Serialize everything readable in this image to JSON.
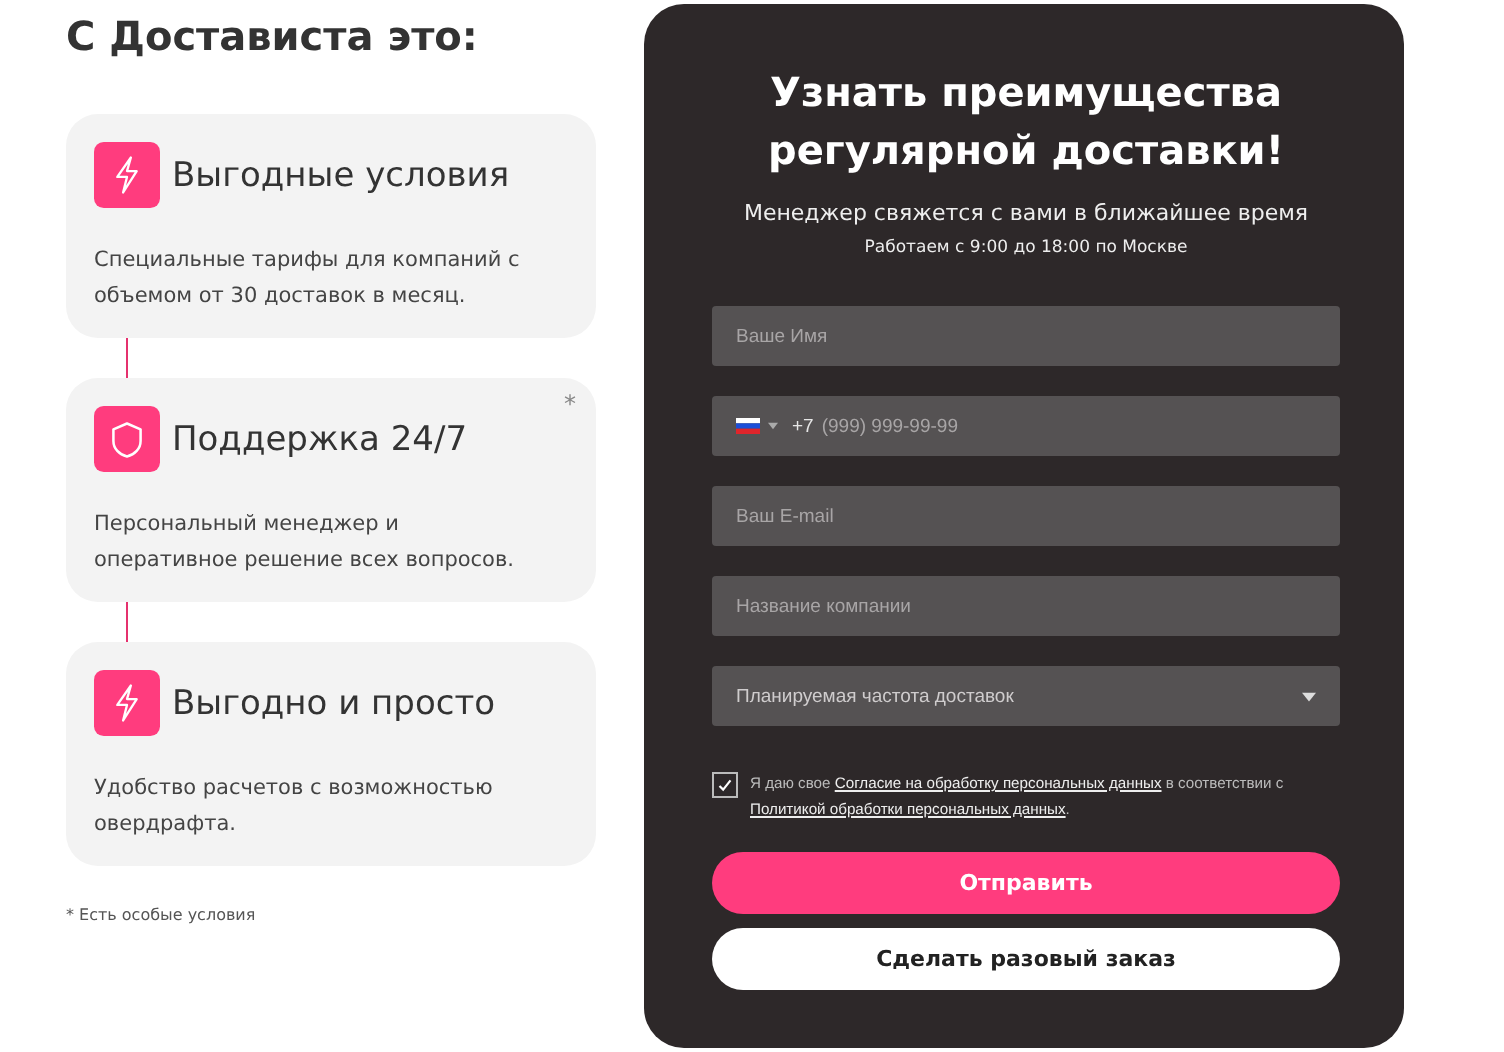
{
  "heading": "С Достависта это:",
  "cards": [
    {
      "kind": "bolt",
      "title": "Выгодные условия",
      "text": "Специальные тарифы для компаний с объемом от 30 доставок в месяц."
    },
    {
      "kind": "shield",
      "title": "Поддержка 24/7",
      "text": "Персональный менеджер и оперативное решение всех вопросов.",
      "asterisk": "*"
    },
    {
      "kind": "bolt",
      "title": "Выгодно и просто",
      "text": "Удобство расчетов с возможностью овердрафта."
    }
  ],
  "footnote": "* Есть особые условия",
  "form": {
    "title": "Узнать преимущества регулярной доставки!",
    "subtitle": "Менеджер свяжется с вами в ближайшее время",
    "hours": "Работаем с 9:00 до 18:00 по Москве",
    "fields": [
      {
        "kind": "text",
        "placeholder": "Ваше Имя"
      },
      {
        "kind": "phone",
        "prefix": "+7",
        "placeholder": "(999) 999-99-99"
      },
      {
        "kind": "text",
        "placeholder": "Ваш E-mail"
      },
      {
        "kind": "text",
        "placeholder": "Название компании"
      },
      {
        "kind": "select",
        "placeholder": "Планируемая частота доставок"
      }
    ],
    "consent": {
      "checked": true,
      "before": "Я даю свое",
      "link1": "Согласие на обработку персональных данных",
      "middle": "в соответствии с",
      "link2": "Политикой обработки персональных данных",
      "after": "."
    },
    "submit": "Отправить",
    "secondary": "Сделать разовый заказ"
  }
}
